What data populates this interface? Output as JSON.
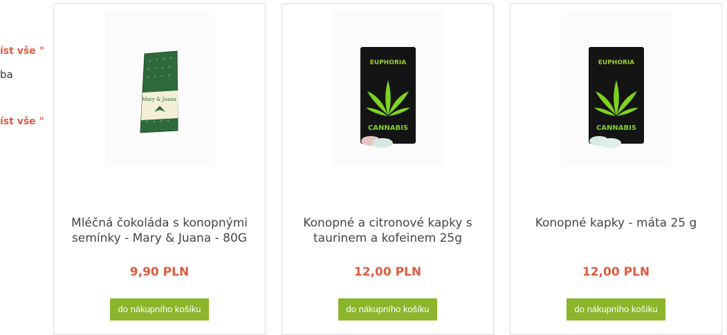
{
  "sidebar": {
    "link1": "íst vše \"",
    "text1": "ba",
    "link2": "íst vše \""
  },
  "products": [
    {
      "title": "Mléčná čokoláda s konopnými semínky - Mary & Juana - 80G",
      "price": "9,90 PLN",
      "button": "do nákupního košíku",
      "image": {
        "brand": "Mary & Juana"
      }
    },
    {
      "title": "Konopné a citronové kapky s taurinem a kofeinem 25g",
      "price": "12,00 PLN",
      "button": "do nákupního košíku",
      "image": {
        "brand": "EUPHORIA",
        "label": "CANNABIS"
      }
    },
    {
      "title": "Konopné kapky - máta 25 g",
      "price": "12,00 PLN",
      "button": "do nákupního košíku",
      "image": {
        "brand": "EUPHORIA",
        "label": "CANNABIS"
      }
    }
  ],
  "colors": {
    "accent": "#e05a3f",
    "button": "#8bb52b",
    "border": "#dcdcdc"
  }
}
